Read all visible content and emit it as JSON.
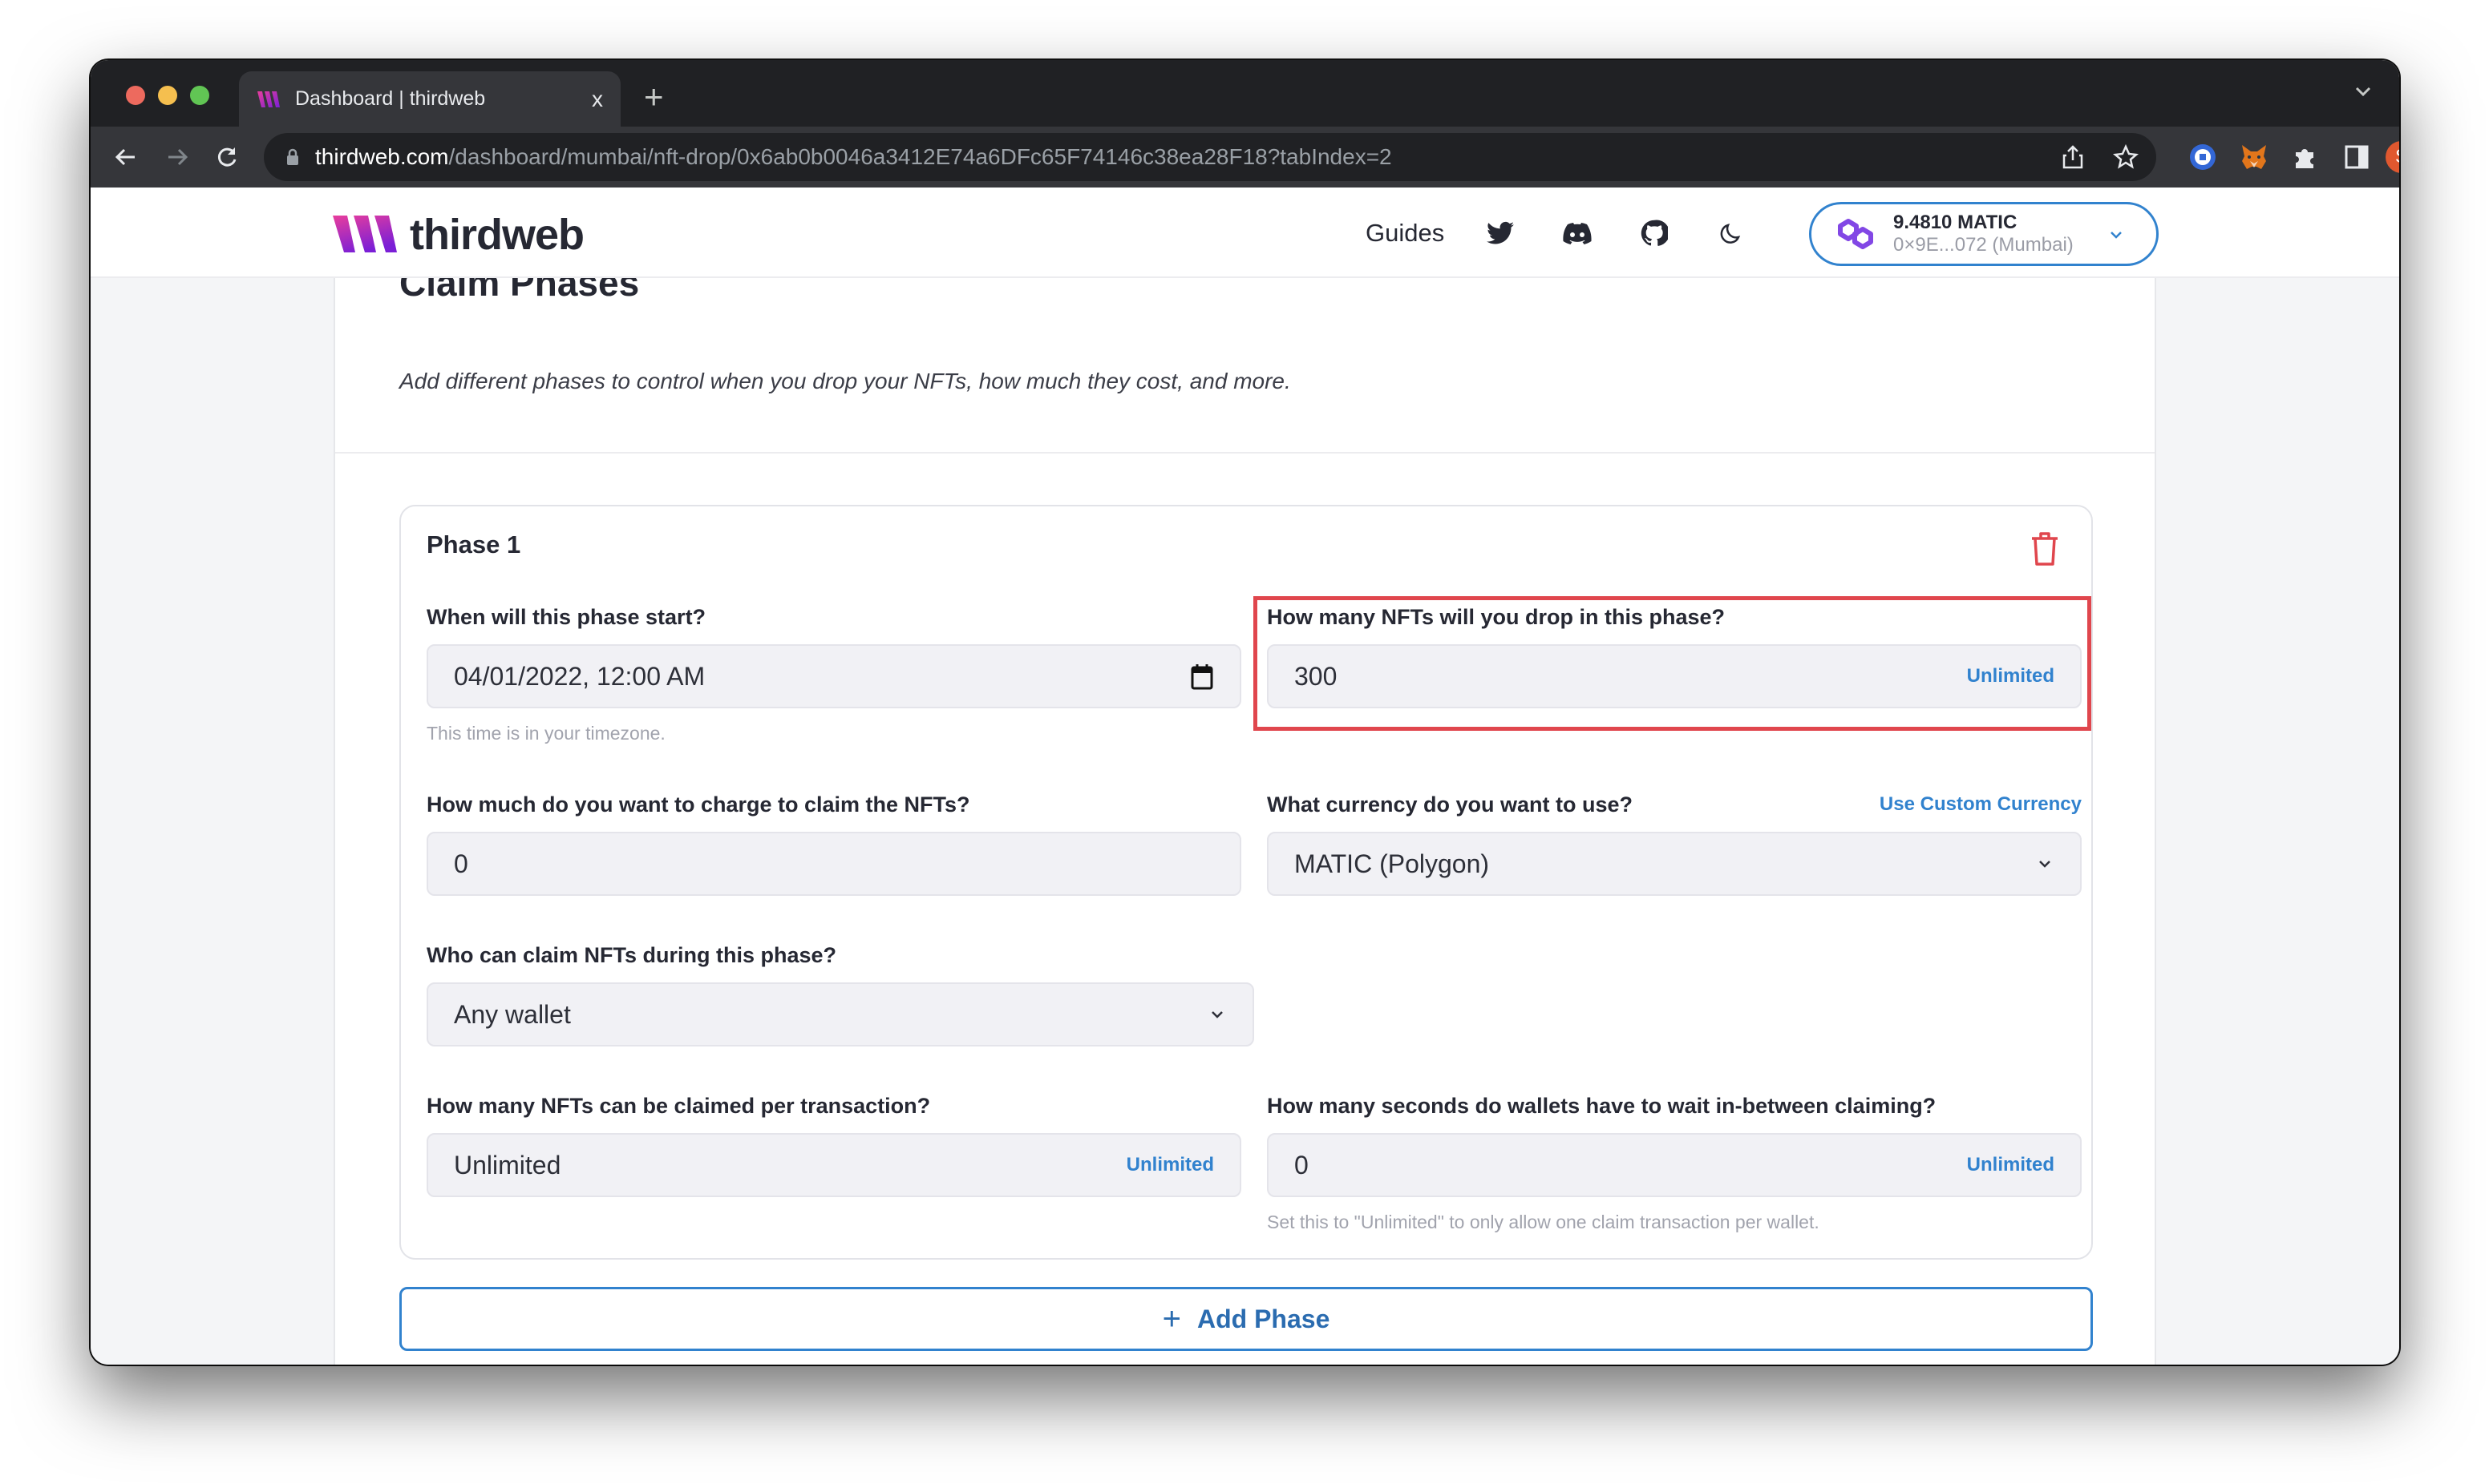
{
  "browser": {
    "tab_title": "Dashboard | thirdweb",
    "tab_close": "x",
    "new_tab": "+",
    "url_host": "thirdweb.com",
    "url_path": "/dashboard/mumbai/nft-drop/0x6ab0b0046a3412E74a6DFc65F74146c38ea28F18?tabIndex=2",
    "profile_initial": "S",
    "profile_color": "#e0582f"
  },
  "header": {
    "brand": "thirdweb",
    "nav_guides": "Guides",
    "icons": [
      "twitter-icon",
      "discord-icon",
      "github-icon",
      "moon-icon"
    ],
    "wallet": {
      "balance": "9.4810 MATIC",
      "address": "0×9E...072 (Mumbai)"
    }
  },
  "section": {
    "title": "Claim Phases",
    "subtitle": "Add different phases to control when you drop your NFTs, how much they cost, and more."
  },
  "phase": {
    "title": "Phase 1",
    "fields": {
      "start": {
        "label": "When will this phase start?",
        "value": "04/01/2022, 12:00 AM",
        "help": "This time is in your timezone."
      },
      "supply": {
        "label": "How many NFTs will you drop in this phase?",
        "value": "300",
        "action": "Unlimited"
      },
      "price": {
        "label": "How much do you want to charge to claim the NFTs?",
        "value": "0"
      },
      "currency": {
        "label": "What currency do you want to use?",
        "link": "Use Custom Currency",
        "value": "MATIC (Polygon)"
      },
      "who": {
        "label": "Who can claim NFTs during this phase?",
        "value": "Any wallet"
      },
      "per_tx": {
        "label": "How many NFTs can be claimed per transaction?",
        "value": "Unlimited",
        "action": "Unlimited"
      },
      "wait": {
        "label": "How many seconds do wallets have to wait in-between claiming?",
        "value": "0",
        "action": "Unlimited",
        "help": "Set this to \"Unlimited\" to only allow one claim transaction per wallet."
      }
    }
  },
  "actions": {
    "add_phase": "Add Phase"
  },
  "colors": {
    "accent": "#3182ce",
    "danger": "#e0464d",
    "brand_gradient": [
      "#e83e9c",
      "#7b1fd6"
    ]
  }
}
